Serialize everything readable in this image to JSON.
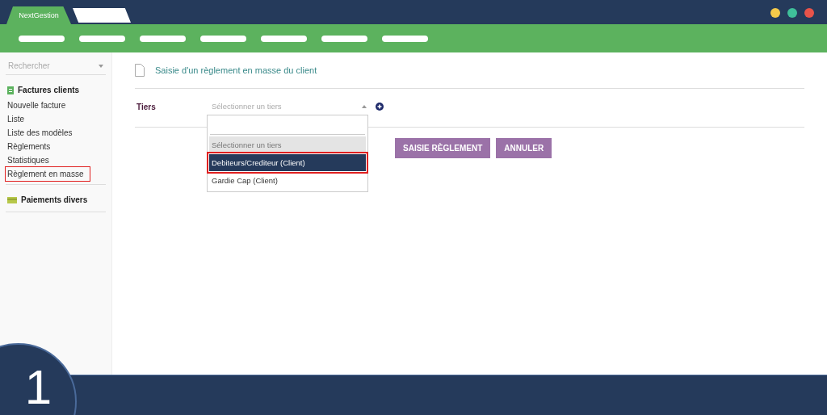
{
  "app_tabs": [
    {
      "label": "NextGestion",
      "selected": true
    },
    {
      "selected": false
    }
  ],
  "sidebar": {
    "search": {
      "placeholder": "Rechercher"
    },
    "sections": [
      {
        "title": "Factures clients",
        "kind": "invoice",
        "items": [
          {
            "label": "Nouvelle facture",
            "highlighted": false
          },
          {
            "label": "Liste",
            "highlighted": false
          },
          {
            "label": "Liste des modèles",
            "highlighted": false
          },
          {
            "label": "Règlements",
            "highlighted": false
          },
          {
            "label": "Statistiques",
            "highlighted": false
          },
          {
            "label": "Règlement en masse",
            "highlighted": true
          }
        ]
      },
      {
        "title": "Paiements divers",
        "kind": "card"
      }
    ]
  },
  "page": {
    "title": "Saisie d'un règlement en masse du client",
    "field": {
      "label": "Tiers",
      "placeholder": "Sélectionner un tiers",
      "expanded": true,
      "options": [
        {
          "label": "Sélectionner un tiers",
          "kind": "placeholder",
          "selected": false,
          "highlighted": false
        },
        {
          "label": "Debiteurs/Crediteur (Client)",
          "kind": "option",
          "selected": true,
          "highlighted": true
        },
        {
          "label": "Gardie Cap (Client)",
          "kind": "option",
          "selected": false,
          "highlighted": false
        }
      ]
    },
    "buttons": [
      "SAISIE RÈGLEMENT",
      "ANNULER"
    ]
  },
  "step": "1"
}
